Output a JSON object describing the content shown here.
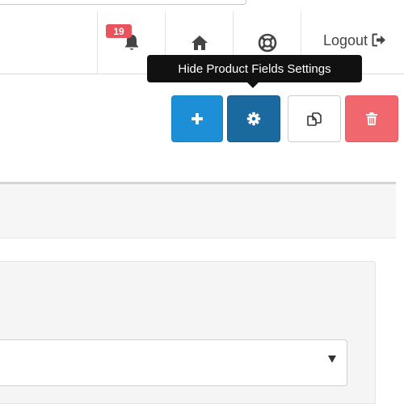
{
  "header": {
    "notifications": {
      "count": "19",
      "icon": "bell-icon"
    },
    "home_icon": "home-icon",
    "help_icon": "life-ring-icon",
    "logout": {
      "label": "Logout",
      "icon": "sign-out-icon"
    }
  },
  "tooltip": {
    "text": "Hide Product Fields Settings"
  },
  "toolbar": {
    "add": {
      "icon": "plus-icon",
      "color": "#1d8fd6"
    },
    "settings": {
      "icon": "gear-icon",
      "color": "#1a6aa0"
    },
    "copy": {
      "icon": "copy-icon",
      "color": "#ffffff"
    },
    "delete": {
      "icon": "trash-icon",
      "color": "#f0686d"
    }
  },
  "form": {
    "select": {
      "value": ""
    }
  },
  "colors": {
    "badge": "#e8535d",
    "tooltip_bg": "#111111"
  }
}
